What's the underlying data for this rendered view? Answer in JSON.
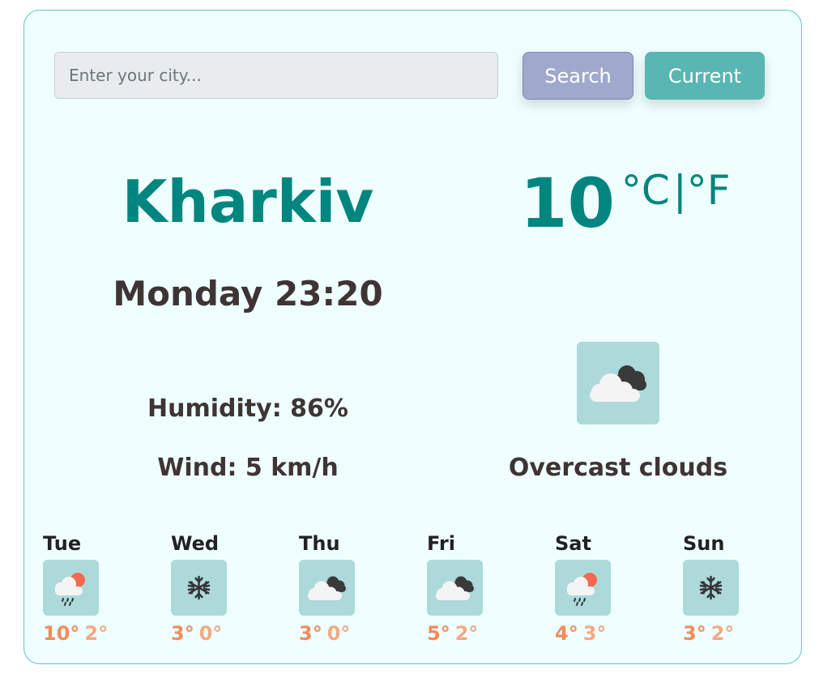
{
  "search": {
    "placeholder": "Enter your city...",
    "button_label": "Search",
    "current_label": "Current"
  },
  "current": {
    "city": "Kharkiv",
    "temperature": "10",
    "unit_celsius": "°C",
    "unit_separator": "|",
    "unit_fahrenheit": "°F",
    "datetime": "Monday 23:20",
    "humidity": "Humidity: 86%",
    "wind": "Wind: 5 km/h",
    "icon": "overcast-clouds-icon",
    "description": "Overcast clouds"
  },
  "forecast": [
    {
      "day": "Tue",
      "icon": "rain-sun-icon",
      "max": "10°",
      "min": "2°"
    },
    {
      "day": "Wed",
      "icon": "snow-icon",
      "max": "3°",
      "min": "0°"
    },
    {
      "day": "Thu",
      "icon": "overcast-clouds-icon",
      "max": "3°",
      "min": "0°"
    },
    {
      "day": "Fri",
      "icon": "overcast-clouds-icon",
      "max": "5°",
      "min": "2°"
    },
    {
      "day": "Sat",
      "icon": "rain-sun-icon",
      "max": "4°",
      "min": "3°"
    },
    {
      "day": "Sun",
      "icon": "snow-icon",
      "max": "3°",
      "min": "2°"
    }
  ],
  "colors": {
    "accent": "#00857f",
    "card_background": "#effefe",
    "search_button": "#9fa9cc",
    "current_button": "#58b7b2",
    "icon_tile": "#add9db",
    "max_temp": "#f08c5c",
    "min_temp": "#f5a982"
  }
}
